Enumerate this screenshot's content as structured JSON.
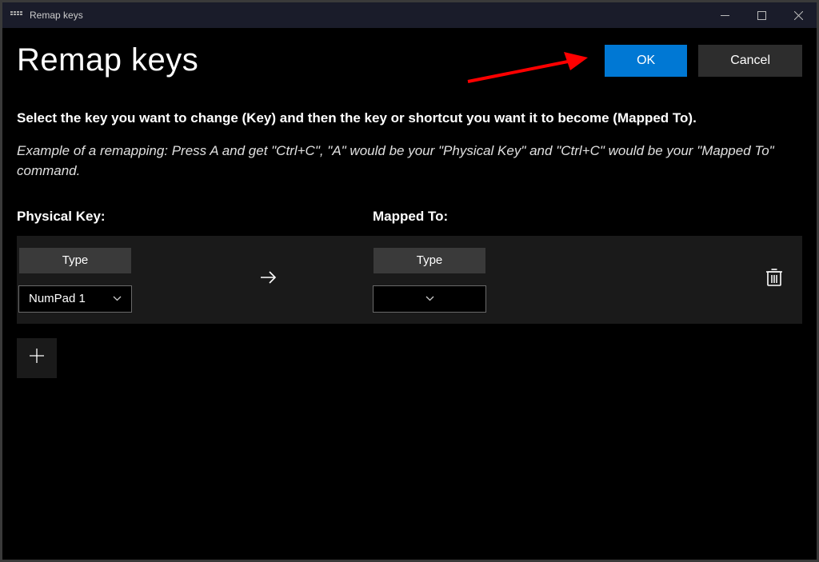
{
  "window": {
    "title": "Remap keys"
  },
  "header": {
    "title": "Remap keys",
    "ok": "OK",
    "cancel": "Cancel"
  },
  "body": {
    "instruction": "Select the key you want to change (Key) and then the key or shortcut you want it to become (Mapped To).",
    "example": "Example of a remapping: Press A and get \"Ctrl+C\", \"A\" would be your \"Physical Key\" and \"Ctrl+C\" would be your \"Mapped To\" command."
  },
  "columns": {
    "physical": "Physical Key:",
    "mapped": "Mapped To:"
  },
  "row": {
    "type_left": "Type",
    "select_left": "NumPad 1",
    "type_right": "Type",
    "select_right": ""
  }
}
